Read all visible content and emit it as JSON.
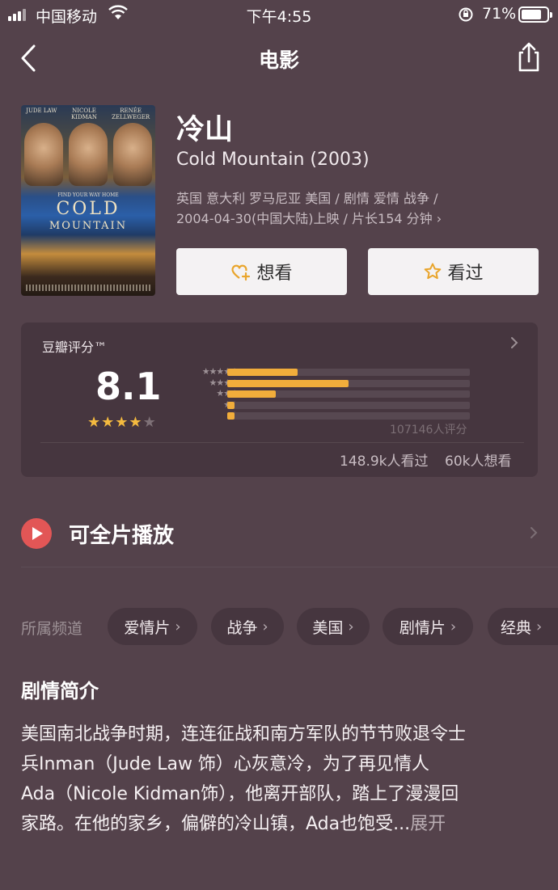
{
  "status_bar": {
    "carrier": "中国移动",
    "time": "下午4:55",
    "battery": "71%"
  },
  "nav": {
    "title": "电影"
  },
  "movie": {
    "title_cn": "冷山",
    "title_en": "Cold Mountain (2003)",
    "meta_line1": "英国 意大利 罗马尼亚 美国 / 剧情 爱情 战争 /",
    "meta_line2": "2004-04-30(中国大陆)上映 / 片长154 分钟",
    "poster": {
      "credit_1": "JUDE LAW",
      "credit_2": "NICOLE KIDMAN",
      "credit_3": "RENÉE ZELLWEGER",
      "tagline": "FIND YOUR WAY HOME",
      "title_line1": "COLD",
      "title_line2": "MOUNTAIN"
    }
  },
  "actions": {
    "want_label": "想看",
    "seen_label": "看过"
  },
  "rating": {
    "title": "豆瓣评分™",
    "score": "8.1",
    "stars_filled": 4,
    "stars_total": 5,
    "distribution": [
      {
        "stars": 5,
        "fraction": 0.29
      },
      {
        "stars": 4,
        "fraction": 0.5
      },
      {
        "stars": 3,
        "fraction": 0.2
      },
      {
        "stars": 2,
        "fraction": 0.03
      },
      {
        "stars": 1,
        "fraction": 0.03
      }
    ],
    "votes": "107146人评分",
    "seen_count": "148.9k人看过",
    "want_count": "60k人想看"
  },
  "play": {
    "label": "可全片播放"
  },
  "channels": {
    "label": "所属频道",
    "items": [
      "爱情片",
      "战争",
      "美国",
      "剧情片",
      "经典"
    ]
  },
  "synopsis": {
    "title": "剧情简介",
    "line1": "美国南北战争时期，连连征战和南方军队的节节败退令士",
    "line2": "兵Inman（Jude Law 饰）心灰意冷，为了再见情人",
    "line3": "Ada（Nicole Kidman饰），他离开部队，踏上了漫漫回",
    "line4": "家路。在他的家乡，偏僻的冷山镇，Ada也饱受...",
    "expand": "展开"
  },
  "colors": {
    "background": "#54424b",
    "card": "#46363f",
    "star": "#f4ba3f",
    "bar": "#f1ad3b",
    "play": "#e25656"
  }
}
